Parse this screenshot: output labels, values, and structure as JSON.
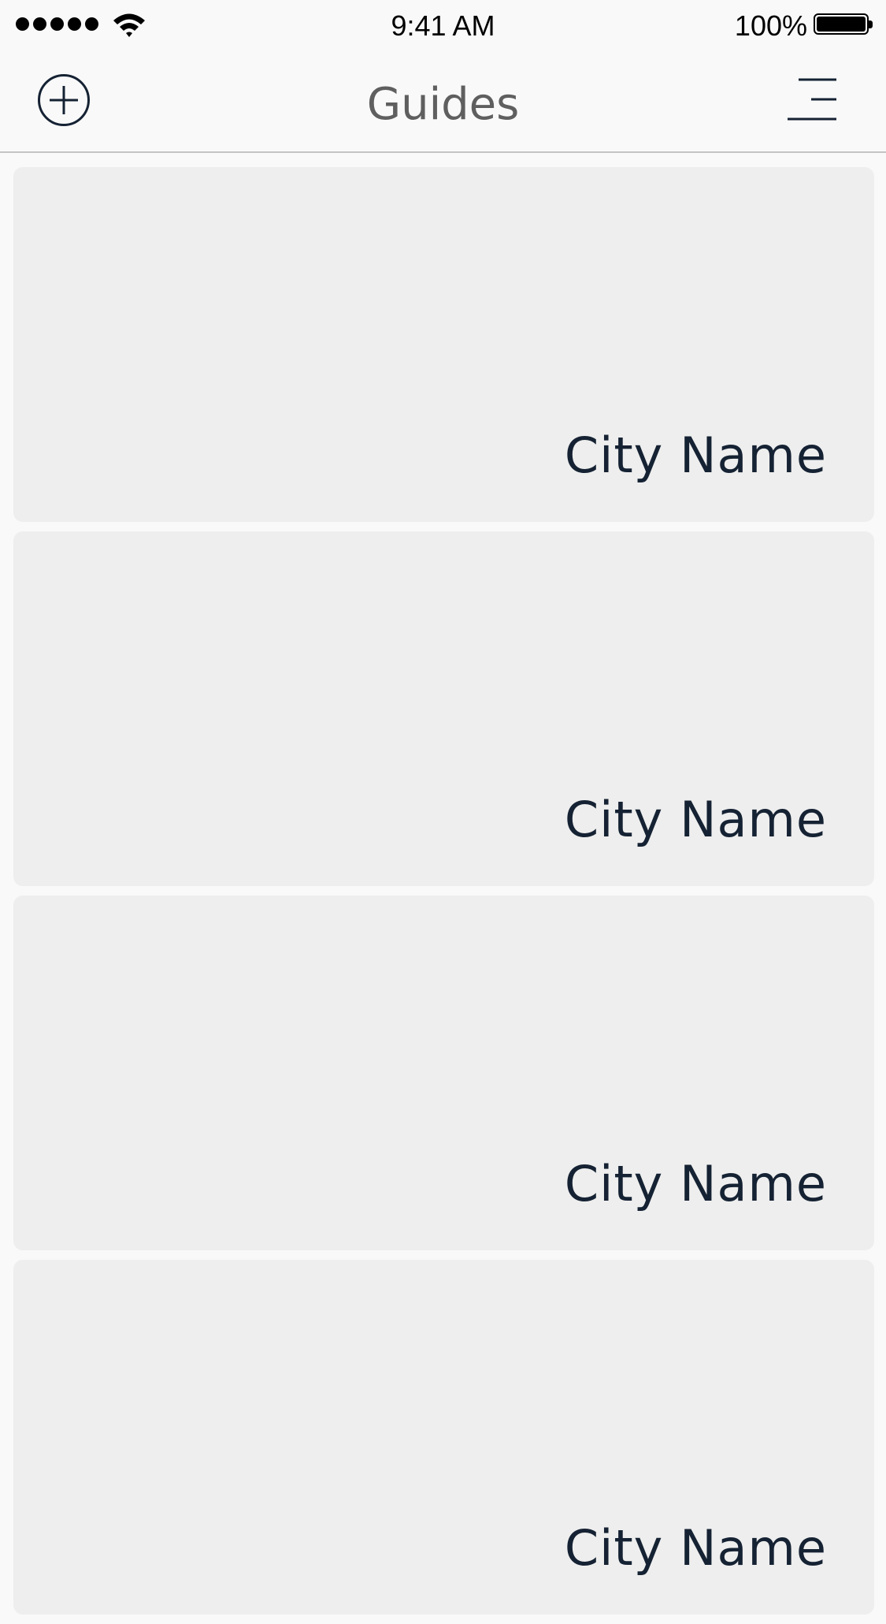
{
  "status_bar": {
    "time": "9:41 AM",
    "battery_percent": "100%",
    "signal_bars": 5,
    "icons": [
      "signal-icon",
      "wifi-icon",
      "battery-icon"
    ]
  },
  "nav": {
    "title": "Guides",
    "left_icon": "add-circle-icon",
    "right_icon": "menu-icon"
  },
  "colors": {
    "background": "#f9f9f9",
    "card": "#eeeeee",
    "card_text": "#152233",
    "title_text": "#5f5f5f",
    "divider": "#c4c4c4"
  },
  "guides": [
    {
      "city": "City Name"
    },
    {
      "city": "City Name"
    },
    {
      "city": "City Name"
    },
    {
      "city": "City Name"
    }
  ]
}
